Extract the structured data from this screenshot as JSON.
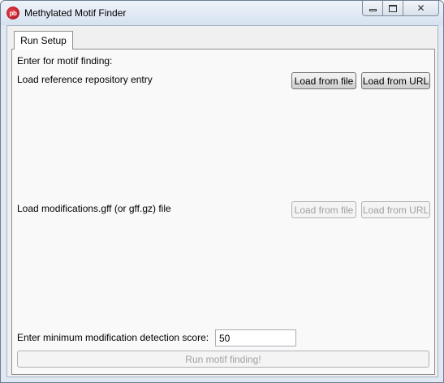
{
  "window": {
    "title": "Methylated Motif Finder",
    "icon_text": "pb",
    "buttons": {
      "minimize": "minimize-icon",
      "maximize": "maximize-icon",
      "close": "close-icon",
      "close_glyph": "✕"
    }
  },
  "tabs": [
    {
      "label": "Run Setup",
      "selected": true
    }
  ],
  "run_setup": {
    "intro_label": "Enter for motif finding:",
    "reference": {
      "label": "Load reference repository entry",
      "load_file_label": "Load from file",
      "load_url_label": "Load from URL",
      "enabled": true
    },
    "modifications": {
      "label": "Load modifications.gff (or gff.gz) file",
      "load_file_label": "Load from file",
      "load_url_label": "Load from URL",
      "enabled": false
    },
    "min_score": {
      "label": "Enter minimum modification detection score:",
      "value": "50"
    },
    "run_button_label": "Run motif finding!",
    "run_enabled": false
  },
  "colors": {
    "title_bar": "#dfe8f3",
    "panel": "#f9f9f9",
    "disabled_text": "#a0a0a0",
    "app_icon": "#c0202c"
  }
}
